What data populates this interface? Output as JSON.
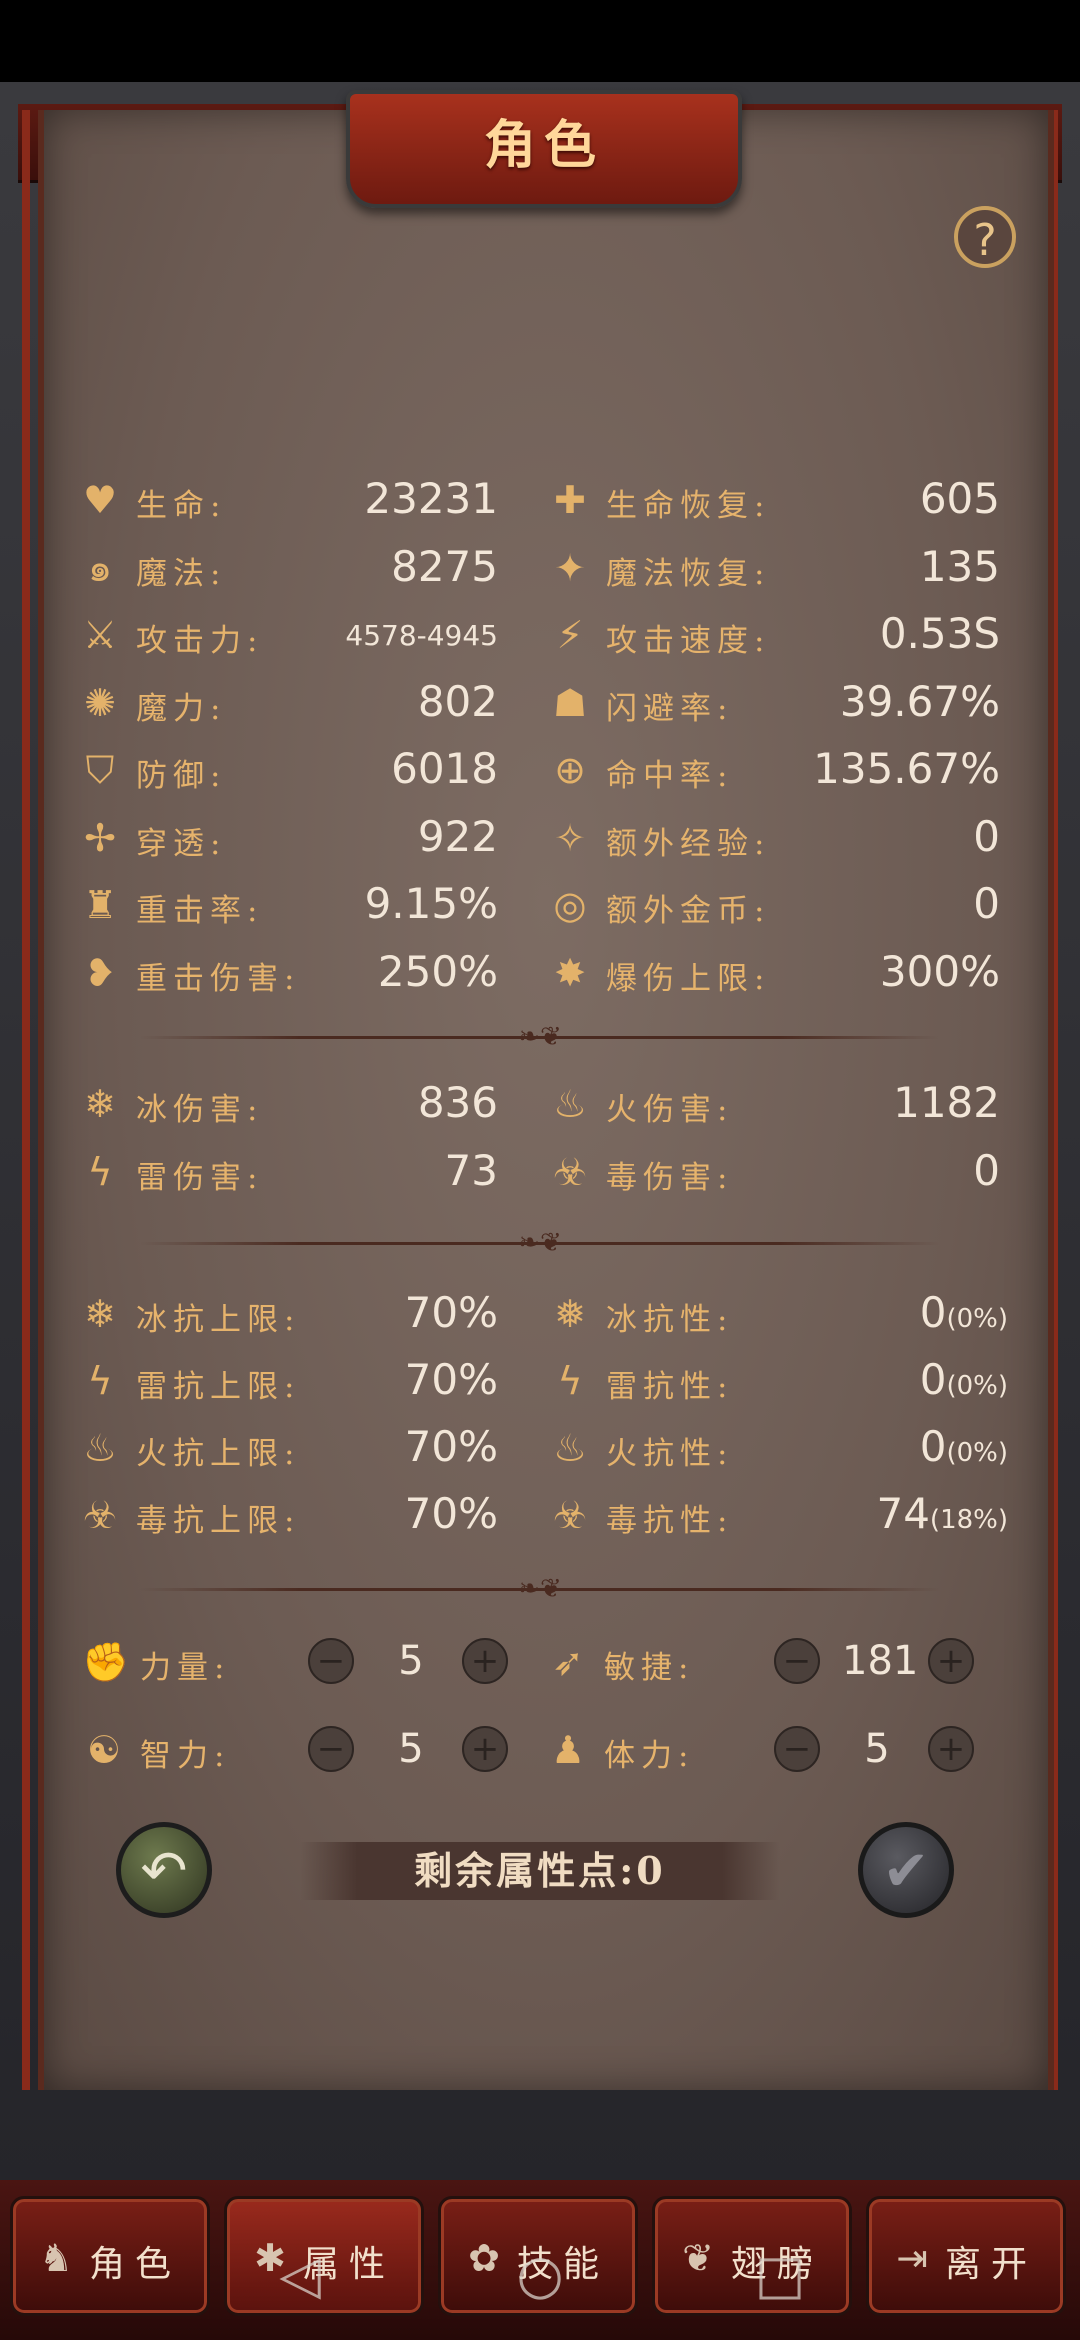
{
  "title": "角色",
  "help_icon": "?",
  "stats": [
    {
      "label": "生命:",
      "value": "23231",
      "icon": "♥",
      "name": "hp"
    },
    {
      "label": "生命恢复:",
      "value": "605",
      "icon": "✚",
      "name": "hp-regen"
    },
    {
      "label": "魔法:",
      "value": "8275",
      "icon": "๑",
      "name": "mp"
    },
    {
      "label": "魔法恢复:",
      "value": "135",
      "icon": "✦",
      "name": "mp-regen"
    },
    {
      "label": "攻击力:",
      "value": "4578-4945",
      "icon": "⚔",
      "name": "attack",
      "small": true
    },
    {
      "label": "攻击速度:",
      "value": "0.53S",
      "icon": "⚡",
      "name": "attack-speed"
    },
    {
      "label": "魔力:",
      "value": "802",
      "icon": "✺",
      "name": "magic-power"
    },
    {
      "label": "闪避率:",
      "value": "39.67%",
      "icon": "☗",
      "name": "dodge-rate"
    },
    {
      "label": "防御:",
      "value": "6018",
      "icon": "⛉",
      "name": "defense"
    },
    {
      "label": "命中率:",
      "value": "135.67%",
      "icon": "⊕",
      "name": "hit-rate"
    },
    {
      "label": "穿透:",
      "value": "922",
      "icon": "✢",
      "name": "penetration"
    },
    {
      "label": "额外经验:",
      "value": "0",
      "icon": "✧",
      "name": "extra-exp"
    },
    {
      "label": "重击率:",
      "value": "9.15%",
      "icon": "♜",
      "name": "crit-rate"
    },
    {
      "label": "额外金币:",
      "value": "0",
      "icon": "◎",
      "name": "extra-gold"
    },
    {
      "label": "重击伤害:",
      "value": "250%",
      "icon": "❥",
      "name": "crit-damage"
    },
    {
      "label": "爆伤上限:",
      "value": "300%",
      "icon": "✸",
      "name": "crit-cap"
    }
  ],
  "elements": [
    {
      "label": "冰伤害:",
      "value": "836",
      "icon": "❄",
      "name": "ice-damage"
    },
    {
      "label": "火伤害:",
      "value": "1182",
      "icon": "♨",
      "name": "fire-damage"
    },
    {
      "label": "雷伤害:",
      "value": "73",
      "icon": "ϟ",
      "name": "thunder-damage"
    },
    {
      "label": "毒伤害:",
      "value": "0",
      "icon": "☣",
      "name": "poison-damage"
    }
  ],
  "resists": [
    {
      "label": "冰抗上限:",
      "value": "70%",
      "icon": "❄",
      "name": "ice-resist-cap"
    },
    {
      "label": "冰抗性:",
      "value": "0",
      "pct": "(0%)",
      "icon": "❅",
      "name": "ice-resist"
    },
    {
      "label": "雷抗上限:",
      "value": "70%",
      "icon": "ϟ",
      "name": "thunder-resist-cap"
    },
    {
      "label": "雷抗性:",
      "value": "0",
      "pct": "(0%)",
      "icon": "ϟ",
      "name": "thunder-resist"
    },
    {
      "label": "火抗上限:",
      "value": "70%",
      "icon": "♨",
      "name": "fire-resist-cap"
    },
    {
      "label": "火抗性:",
      "value": "0",
      "pct": "(0%)",
      "icon": "♨",
      "name": "fire-resist"
    },
    {
      "label": "毒抗上限:",
      "value": "70%",
      "icon": "☣",
      "name": "poison-resist-cap"
    },
    {
      "label": "毒抗性:",
      "value": "74",
      "pct": "(18%)",
      "icon": "☣",
      "name": "poison-resist"
    }
  ],
  "attributes": [
    {
      "label": "力量:",
      "value": "5",
      "icon": "✊",
      "name": "strength"
    },
    {
      "label": "敏捷:",
      "value": "181",
      "icon": "➶",
      "name": "agility"
    },
    {
      "label": "智力:",
      "value": "5",
      "icon": "☯",
      "name": "intelligence"
    },
    {
      "label": "体力:",
      "value": "5",
      "icon": "♟",
      "name": "stamina"
    }
  ],
  "minus": "−",
  "plus": "+",
  "remaining_points": "剩余属性点:0",
  "undo_icon": "↶",
  "confirm_icon": "✔",
  "tabs": [
    {
      "label": "角色",
      "icon": "♞",
      "name": "tab-character"
    },
    {
      "label": "属性",
      "icon": "✱",
      "name": "tab-attributes"
    },
    {
      "label": "技能",
      "icon": "✿",
      "name": "tab-skills"
    },
    {
      "label": "翅膀",
      "icon": "❦",
      "name": "tab-wings"
    },
    {
      "label": "离开",
      "icon": "⇥",
      "name": "tab-leave"
    }
  ],
  "nav": {
    "back": "◁",
    "home": "○",
    "recent": "□"
  }
}
